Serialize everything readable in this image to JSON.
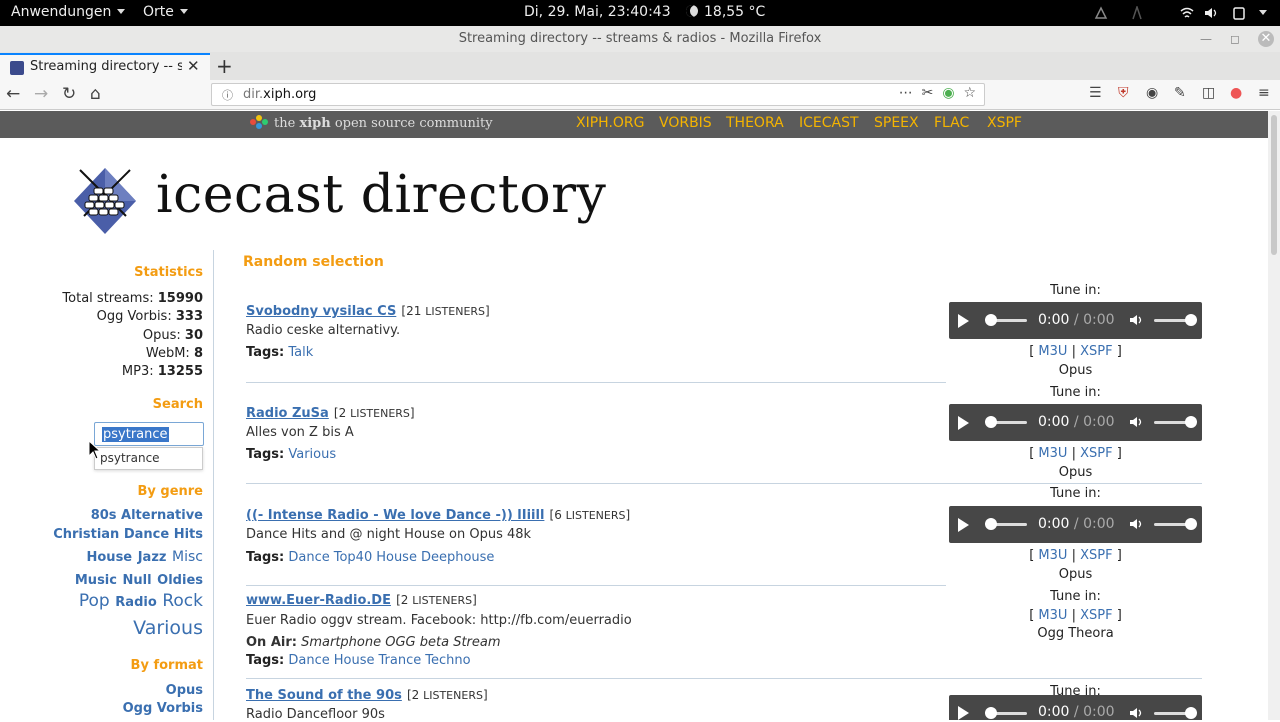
{
  "topbar": {
    "apps": "Anwendungen",
    "places": "Orte",
    "clock": "Di, 29. Mai, 23:40:43",
    "weather": "18,55 °C"
  },
  "window": {
    "title": "Streaming directory -- streams & radios - Mozilla Firefox"
  },
  "tab": {
    "title": "Streaming directory -- streams & radios"
  },
  "urlbar": {
    "url_prefix": "dir.",
    "url_domain": "xiph.org"
  },
  "xiph": {
    "community_pre": "the",
    "community_brand": "xiph",
    "community_post": "open source community",
    "links": [
      "XIPH.ORG",
      "VORBIS",
      "THEORA",
      "ICECAST",
      "SPEEX",
      "FLAC",
      "XSPF"
    ],
    "link_color": "#f5b400"
  },
  "site": {
    "title": "icecast directory"
  },
  "sidebar": {
    "statistics_heading": "Statistics",
    "stats": [
      {
        "label": "Total streams:",
        "value": "15990"
      },
      {
        "label": "Ogg Vorbis:",
        "value": "333"
      },
      {
        "label": "Opus:",
        "value": "30"
      },
      {
        "label": "WebM:",
        "value": "8"
      },
      {
        "label": "MP3:",
        "value": "13255"
      }
    ],
    "search_heading": "Search",
    "search_value": "psytrance",
    "autocomplete_option": "psytrance",
    "genre_heading": "By genre",
    "genres": {
      "g0": "80s Alternative",
      "g1": "Christian Dance Hits",
      "g2a": "House",
      "g2b": "Jazz",
      "g2c": "Misc",
      "g3a": "Music",
      "g3b": "Null",
      "g3c": "Oldies",
      "g4a": "Pop",
      "g4b": "Radio",
      "g4c": "Rock",
      "g5": "Various"
    },
    "format_heading": "By format",
    "formats": [
      "Opus",
      "Ogg Vorbis"
    ],
    "heading_color": "#f39c12"
  },
  "main": {
    "heading": "Random selection",
    "tune_in": "Tune in:",
    "m3u": "M3U",
    "xspf": "XSPF",
    "tags_label": "Tags:",
    "onair_label": "On Air:",
    "time_current": "0:00",
    "time_total": "/ 0:00",
    "streams": [
      {
        "name": "Svobodny vysilac CS",
        "listeners": "21",
        "desc": "Radio ceske alternativy.",
        "tags": [
          "Talk"
        ],
        "format": "Opus"
      },
      {
        "name": "Radio ZuSa",
        "listeners": "2",
        "desc": "Alles von Z bis A",
        "tags": [
          "Various"
        ],
        "format": "Opus"
      },
      {
        "name": "((- Intense Radio - We love Dance -)) lIiill",
        "listeners": "6",
        "desc": "Dance Hits and @ night House on Opus 48k",
        "tags": [
          "Dance",
          "Top40",
          "House",
          "Deephouse"
        ],
        "format": "Opus"
      },
      {
        "name": "www.Euer-Radio.DE",
        "listeners": "2",
        "desc": "Euer Radio oggv stream. Facebook: http://fb.com/euerradio",
        "onair": "Smartphone OGG beta Stream",
        "tags": [
          "Dance",
          "House",
          "Trance",
          "Techno"
        ],
        "format": "Ogg Theora"
      },
      {
        "name": "The Sound of the 90s",
        "listeners": "2",
        "desc": "Radio Dancefloor 90s",
        "tags": [],
        "format": ""
      }
    ],
    "listeners_word": "LISTENERS"
  }
}
